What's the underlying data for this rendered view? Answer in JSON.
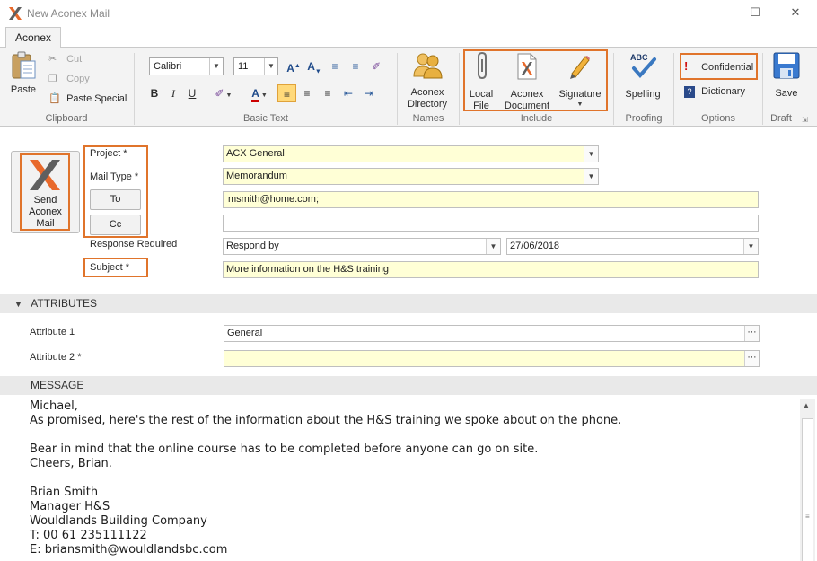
{
  "window": {
    "title": "New Aconex Mail"
  },
  "tabs": [
    "Aconex"
  ],
  "ribbon": {
    "clipboard": {
      "label": "Clipboard",
      "paste": "Paste",
      "cut": "Cut",
      "copy": "Copy",
      "paste_special": "Paste Special"
    },
    "basic_text": {
      "label": "Basic Text",
      "font": "Calibri",
      "size": "11"
    },
    "names": {
      "label": "Names",
      "directory_line1": "Aconex",
      "directory_line2": "Directory"
    },
    "include": {
      "label": "Include",
      "local_line1": "Local",
      "local_line2": "File",
      "doc_line1": "Aconex",
      "doc_line2": "Document",
      "signature": "Signature"
    },
    "proofing": {
      "label": "Proofing",
      "spelling": "Spelling",
      "abc": "ABC"
    },
    "options": {
      "label": "Options",
      "confidential": "Confidential",
      "dictionary": "Dictionary"
    },
    "draft": {
      "label": "Draft",
      "save": "Save"
    }
  },
  "form": {
    "send_line1": "Send",
    "send_line2": "Aconex",
    "send_line3": "Mail",
    "project_label": "Project *",
    "project_value": "ACX General",
    "mail_type_label": "Mail Type *",
    "mail_type_value": "Memorandum",
    "to_label": "To",
    "to_value": "msmith@home.com;",
    "cc_label": "Cc",
    "cc_value": "",
    "response_label": "Response Required",
    "response_value": "Respond by",
    "response_date": "27/06/2018",
    "subject_label": "Subject *",
    "subject_value": "More information on the H&S training"
  },
  "attributes": {
    "header": "ATTRIBUTES",
    "attr1_label": "Attribute 1",
    "attr1_value": "General",
    "attr2_label": "Attribute 2 *",
    "attr2_value": ""
  },
  "message": {
    "header": "MESSAGE",
    "body": "Michael,\nAs promised, here's the rest of the information about the H&S training we spoke about on the phone.\n\nBear in mind that the online course has to be completed before anyone can go on site.\nCheers, Brian.\n\nBrian Smith\nManager H&S\nWouldlands Building Company\nT: 00 61 235111122\nE: briansmith@wouldlandsbc.com"
  },
  "colors": {
    "highlight": "#e0742b",
    "required_field": "#ffffd6",
    "logo_orange": "#e8692b",
    "logo_gray": "#5f5f5f"
  }
}
